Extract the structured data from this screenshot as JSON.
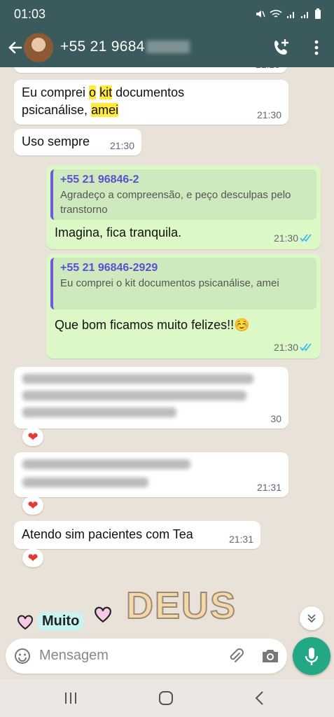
{
  "status_bar": {
    "time": "01:03"
  },
  "header": {
    "contact_visible": "+55 21 9684"
  },
  "messages": [
    {
      "id": "m1",
      "text_parts": [
        "Eu comprei ",
        "o",
        " ",
        "kit",
        " documentos psicanálise, ",
        "amei"
      ],
      "time": "21:30"
    },
    {
      "id": "m2",
      "text": "Uso sempre",
      "time": "21:30"
    },
    {
      "id": "m3",
      "quote_name": "+55 21 96846-2",
      "quote_text": "Agradeço a compreensão, e peço desculpas pelo transtorno",
      "text": "Imagina, fica tranquila.",
      "time": "21:30"
    },
    {
      "id": "m4",
      "quote_name": "+55 21 96846-2929",
      "quote_text": "Eu comprei o kit documentos psicanálise, amei",
      "text": "Que bom ficamos muito felizes!!☺️",
      "time": "21:30"
    },
    {
      "id": "m5",
      "time_visible": "30"
    },
    {
      "id": "m6",
      "time": "21:31"
    },
    {
      "id": "m7",
      "text": "Atendo sim pacientes com Tea",
      "time": "21:31"
    }
  ],
  "reactions": {
    "heart": "❤"
  },
  "sticker": {
    "left_word": "Muito",
    "right_word": "DEUS"
  },
  "composer": {
    "placeholder": "Mensagem"
  },
  "colors": {
    "header": "#3b5a5e",
    "outgoing": "#dcf8c6",
    "incoming": "#ffffff",
    "mic": "#22a884",
    "read_ticks": "#34b7f1"
  }
}
